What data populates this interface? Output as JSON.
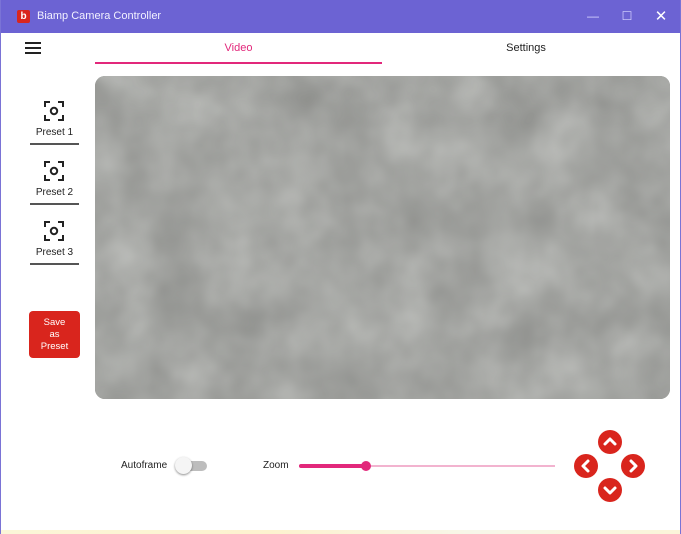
{
  "window": {
    "logo_letter": "b",
    "title": "Biamp Camera Controller",
    "minimize_glyph": "—",
    "maximize_glyph": "☐",
    "close_glyph": "✕",
    "title_bar_color": "#6c63d3"
  },
  "tabs": [
    {
      "label": "Video",
      "active": true
    },
    {
      "label": "Settings",
      "active": false
    }
  ],
  "menu_icon": "hamburger-menu-icon",
  "presets": [
    {
      "label": "Preset 1",
      "icon": "camera-focus-icon"
    },
    {
      "label": "Preset 2",
      "icon": "camera-focus-icon"
    },
    {
      "label": "Preset 3",
      "icon": "camera-focus-icon"
    }
  ],
  "save_preset_label": "Save\nas\nPreset",
  "controls": {
    "autoframe_label": "Autoframe",
    "autoframe_on": false,
    "zoom_label": "Zoom",
    "zoom_value": 0.26
  },
  "ptz_icons": [
    "chevron-up-icon",
    "chevron-left-icon",
    "chevron-right-icon",
    "chevron-down-icon"
  ],
  "colors": {
    "accent": "#e2287b",
    "brand_red": "#d9251d"
  }
}
